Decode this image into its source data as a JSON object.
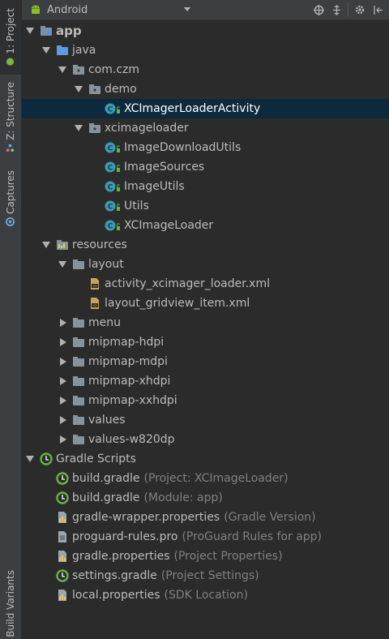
{
  "side_tabs": {
    "project": "1: Project",
    "structure": "Z: Structure",
    "captures": "Captures",
    "build_variants": "Build Variants"
  },
  "toolbar": {
    "view_mode": "Android"
  },
  "tree": [
    {
      "label": "app",
      "hint": "",
      "level": 0,
      "arrow": "down",
      "icon": "module-icon",
      "bold": true
    },
    {
      "label": "java",
      "hint": "",
      "level": 1,
      "arrow": "down",
      "icon": "source-folder-icon"
    },
    {
      "label": "com.czm",
      "hint": "",
      "level": 2,
      "arrow": "down",
      "icon": "package-icon"
    },
    {
      "label": "demo",
      "hint": "",
      "level": 3,
      "arrow": "down",
      "icon": "package-icon"
    },
    {
      "label": "XCImagerLoaderActivity",
      "hint": "",
      "level": 4,
      "arrow": "none",
      "icon": "class-icon",
      "selected": true
    },
    {
      "label": "xcimageloader",
      "hint": "",
      "level": 3,
      "arrow": "down",
      "icon": "package-icon"
    },
    {
      "label": "ImageDownloadUtils",
      "hint": "",
      "level": 4,
      "arrow": "none",
      "icon": "class-icon"
    },
    {
      "label": "ImageSources",
      "hint": "",
      "level": 4,
      "arrow": "none",
      "icon": "class-icon"
    },
    {
      "label": "ImageUtils",
      "hint": "",
      "level": 4,
      "arrow": "none",
      "icon": "class-icon"
    },
    {
      "label": "Utils",
      "hint": "",
      "level": 4,
      "arrow": "none",
      "icon": "class-icon"
    },
    {
      "label": "XCImageLoader",
      "hint": "",
      "level": 4,
      "arrow": "none",
      "icon": "class-icon"
    },
    {
      "label": "resources",
      "hint": "",
      "level": 1,
      "arrow": "down",
      "icon": "resource-folder-icon"
    },
    {
      "label": "layout",
      "hint": "",
      "level": 2,
      "arrow": "down",
      "icon": "folder-icon"
    },
    {
      "label": "activity_xcimager_loader.xml",
      "hint": "",
      "level": 3,
      "arrow": "none",
      "icon": "xml-file-icon"
    },
    {
      "label": "layout_gridview_item.xml",
      "hint": "",
      "level": 3,
      "arrow": "none",
      "icon": "xml-file-icon"
    },
    {
      "label": "menu",
      "hint": "",
      "level": 2,
      "arrow": "right",
      "icon": "folder-icon"
    },
    {
      "label": "mipmap-hdpi",
      "hint": "",
      "level": 2,
      "arrow": "right",
      "icon": "folder-icon"
    },
    {
      "label": "mipmap-mdpi",
      "hint": "",
      "level": 2,
      "arrow": "right",
      "icon": "folder-icon"
    },
    {
      "label": "mipmap-xhdpi",
      "hint": "",
      "level": 2,
      "arrow": "right",
      "icon": "folder-icon"
    },
    {
      "label": "mipmap-xxhdpi",
      "hint": "",
      "level": 2,
      "arrow": "right",
      "icon": "folder-icon"
    },
    {
      "label": "values",
      "hint": "",
      "level": 2,
      "arrow": "right",
      "icon": "folder-icon"
    },
    {
      "label": "values-w820dp",
      "hint": "",
      "level": 2,
      "arrow": "right",
      "icon": "folder-icon"
    },
    {
      "label": "Gradle Scripts",
      "hint": "",
      "level": 0,
      "arrow": "down",
      "icon": "gradle-icon"
    },
    {
      "label": "build.gradle",
      "hint": "(Project: XCImageLoader)",
      "level": 1,
      "arrow": "none",
      "icon": "gradle-icon"
    },
    {
      "label": "build.gradle",
      "hint": "(Module: app)",
      "level": 1,
      "arrow": "none",
      "icon": "gradle-icon"
    },
    {
      "label": "gradle-wrapper.properties",
      "hint": "(Gradle Version)",
      "level": 1,
      "arrow": "none",
      "icon": "properties-file-icon"
    },
    {
      "label": "proguard-rules.pro",
      "hint": "(ProGuard Rules for app)",
      "level": 1,
      "arrow": "none",
      "icon": "text-file-icon"
    },
    {
      "label": "gradle.properties",
      "hint": "(Project Properties)",
      "level": 1,
      "arrow": "none",
      "icon": "properties-file-icon"
    },
    {
      "label": "settings.gradle",
      "hint": "(Project Settings)",
      "level": 1,
      "arrow": "none",
      "icon": "gradle-icon"
    },
    {
      "label": "local.properties",
      "hint": "(SDK Location)",
      "level": 1,
      "arrow": "none",
      "icon": "properties-file-icon"
    }
  ]
}
